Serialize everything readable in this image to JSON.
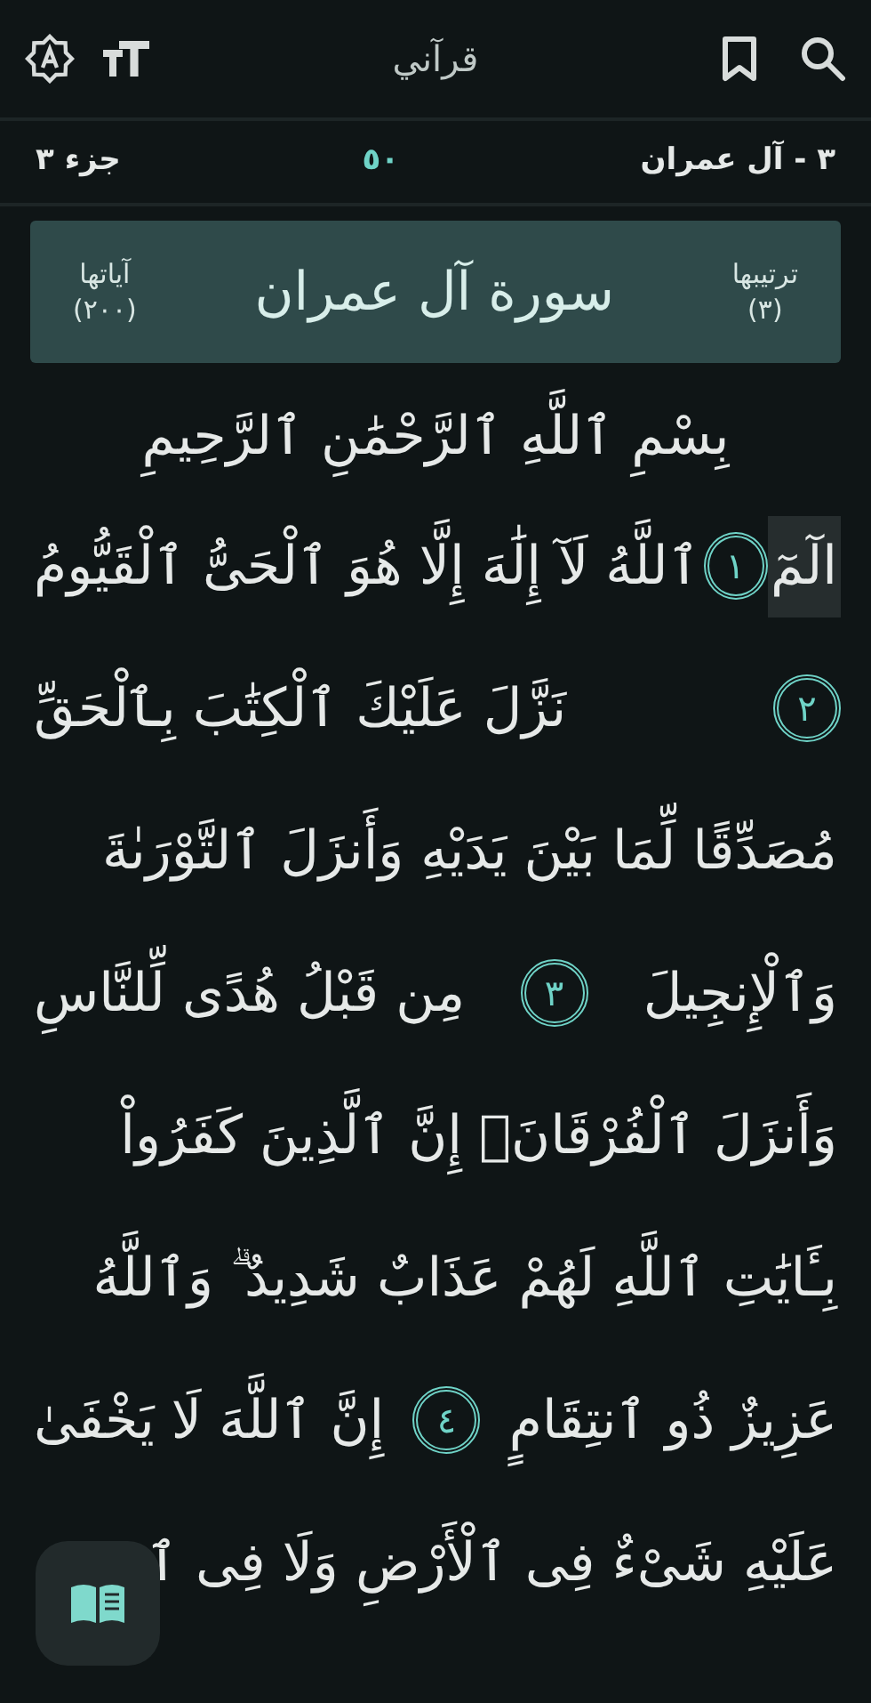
{
  "app_bar": {
    "title": "قرآني"
  },
  "info_bar": {
    "surah": "٣ - آل عمران",
    "page": "٥٠",
    "juz": "جزء ٣"
  },
  "surah_banner": {
    "order_label": "ترتيبها",
    "order": "(٣)",
    "name": "سورة آل عمران",
    "verses_label": "آياتها",
    "verses": "(٢٠٠)"
  },
  "bismillah": "بِسْمِ ٱللَّهِ ٱلرَّحْمَٰنِ ٱلرَّحِيمِ",
  "lines": [
    {
      "segments": [
        {
          "kind": "word",
          "text": "الٓمٓ",
          "highlighted": true
        },
        {
          "kind": "marker",
          "number": "١"
        },
        {
          "kind": "word",
          "text": "ٱللَّهُ لَآ إِلَٰهَ إِلَّا هُوَ ٱلْحَىُّ ٱلْقَيُّومُ",
          "highlighted": false
        }
      ]
    },
    {
      "segments": [
        {
          "kind": "marker",
          "number": "٢"
        },
        {
          "kind": "word",
          "text": "نَزَّلَ عَلَيْكَ ٱلْكِتَٰبَ بِٱلْحَقِّ",
          "highlighted": false
        }
      ]
    },
    {
      "segments": [
        {
          "kind": "word",
          "text": "مُصَدِّقًا لِّمَا بَيْنَ يَدَيْهِ وَأَنزَلَ ٱلتَّوْرَىٰةَ",
          "highlighted": false
        }
      ]
    },
    {
      "segments": [
        {
          "kind": "word",
          "text": "وَٱلْإِنجِيلَ",
          "highlighted": false
        },
        {
          "kind": "marker",
          "number": "٣"
        },
        {
          "kind": "word",
          "text": "مِن قَبْلُ هُدًى لِّلنَّاسِ",
          "highlighted": false
        }
      ]
    },
    {
      "segments": [
        {
          "kind": "word",
          "text": "وَأَنزَلَ ٱلْفُرْقَانَۗ إِنَّ ٱلَّذِينَ كَفَرُواْ",
          "highlighted": false
        }
      ]
    },
    {
      "segments": [
        {
          "kind": "word",
          "text": "بِـَٔايَٰتِ ٱللَّهِ لَهُمْ عَذَابٌ شَدِيدٌ ۗ وَٱللَّهُ",
          "highlighted": false
        }
      ]
    },
    {
      "segments": [
        {
          "kind": "word",
          "text": "عَزِيزٌ ذُو ٱنتِقَامٍ",
          "highlighted": false
        },
        {
          "kind": "marker",
          "number": "٤"
        },
        {
          "kind": "word",
          "text": "إِنَّ ٱللَّهَ لَا يَخْفَىٰ",
          "highlighted": false
        }
      ]
    },
    {
      "segments": [
        {
          "kind": "word",
          "text": "عَلَيْهِ شَىْءٌ فِى ٱلْأَرْضِ وَلَا فِى ٱ",
          "highlighted": false
        }
      ]
    }
  ]
}
